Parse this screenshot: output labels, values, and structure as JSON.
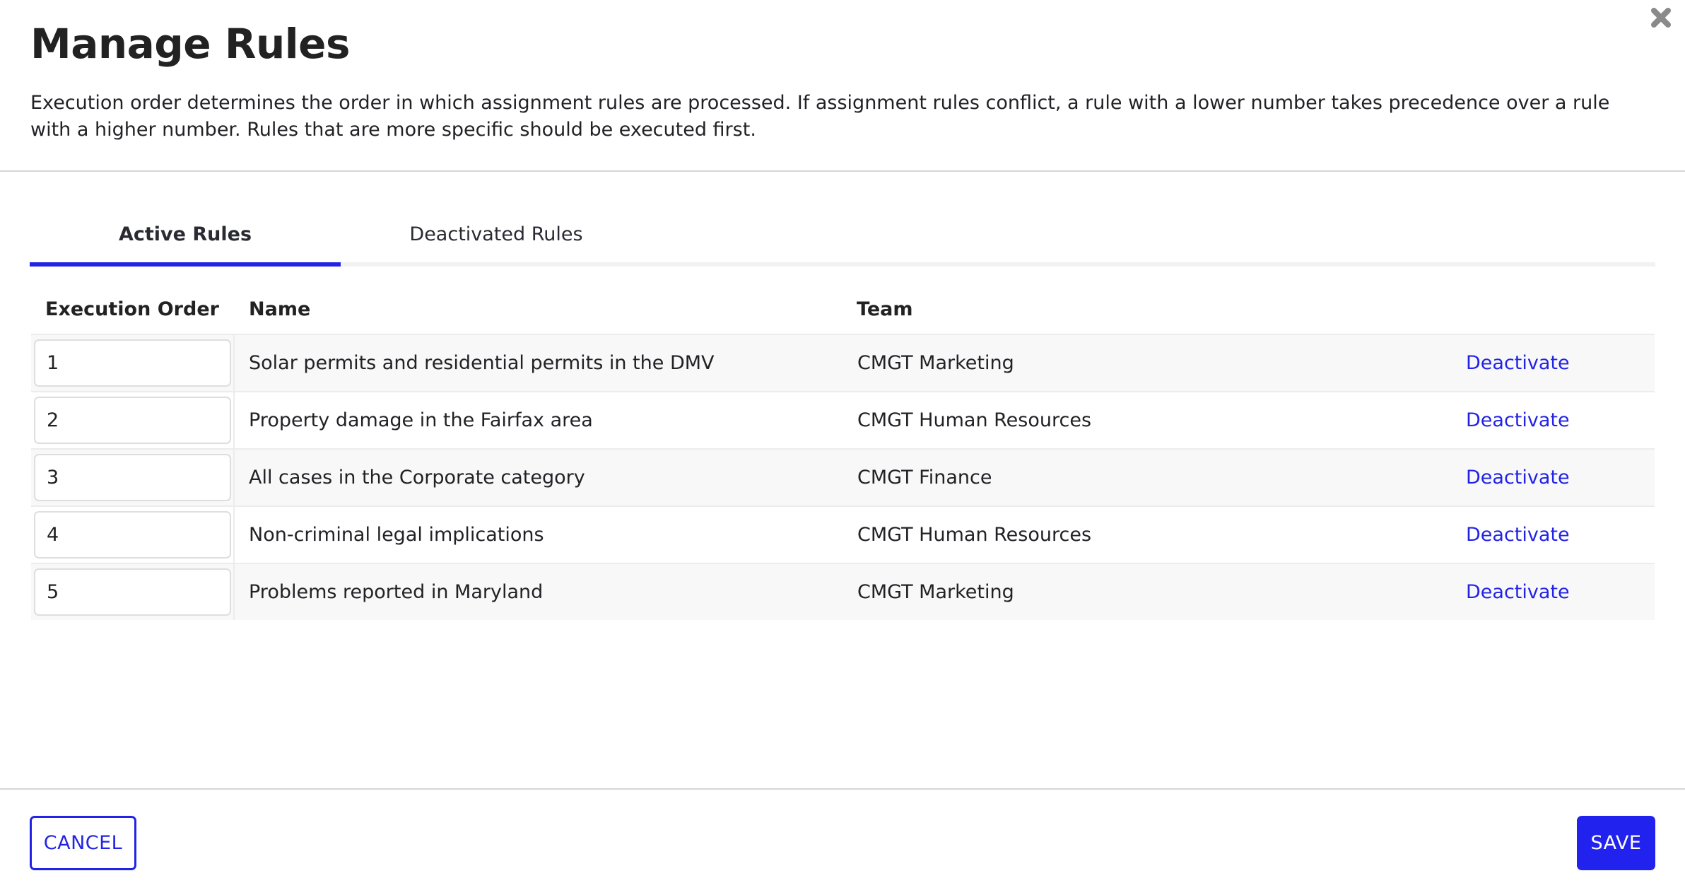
{
  "dialog": {
    "title": "Manage Rules",
    "description": "Execution order determines the order in which assignment rules are processed. If assignment rules conflict, a rule with a lower number takes precedence over a rule with a higher number. Rules that are more specific should be executed first.",
    "close_icon": "close-icon"
  },
  "tabs": [
    {
      "label": "Active Rules",
      "active": true
    },
    {
      "label": "Deactivated Rules",
      "active": false
    }
  ],
  "table": {
    "columns": [
      "Execution Order",
      "Name",
      "Team"
    ],
    "rows": [
      {
        "order": "1",
        "name": "Solar permits and residential permits in the DMV",
        "team": "CMGT Marketing",
        "action": "Deactivate"
      },
      {
        "order": "2",
        "name": "Property damage in the Fairfax area",
        "team": "CMGT Human Resources",
        "action": "Deactivate"
      },
      {
        "order": "3",
        "name": "All cases in the Corporate category",
        "team": "CMGT Finance",
        "action": "Deactivate"
      },
      {
        "order": "4",
        "name": "Non-criminal legal implications",
        "team": "CMGT Human Resources",
        "action": "Deactivate"
      },
      {
        "order": "5",
        "name": "Problems reported in Maryland",
        "team": "CMGT Marketing",
        "action": "Deactivate"
      }
    ]
  },
  "footer": {
    "cancel_label": "CANCEL",
    "save_label": "SAVE"
  },
  "colors": {
    "accent": "#2323e6",
    "row_alt": "#f8f8f8",
    "divider": "#d6d6d6",
    "close_icon": "#8a8a8a"
  }
}
